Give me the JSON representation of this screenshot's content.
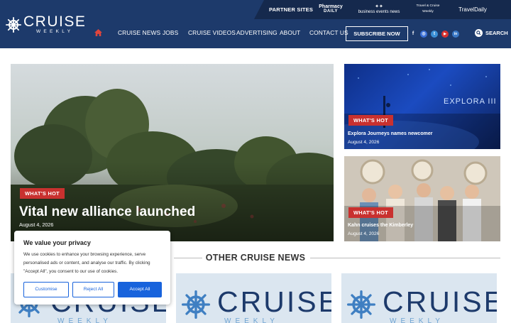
{
  "header": {
    "logo": {
      "main": "CRUISE",
      "sub": "WEEKLY"
    },
    "partner_label": "PARTNER SITES",
    "partners": [
      {
        "line1": "Pharmacy",
        "line2": "DAILY"
      },
      {
        "line1": "business events news",
        "line2": ""
      },
      {
        "line1": "Travel & Cruise",
        "line2": "Weekly"
      },
      {
        "line1": "TravelDaily",
        "line2": ""
      }
    ],
    "nav": [
      "CRUISE NEWS",
      "JOBS",
      "CRUISE VIDEOS",
      "ADVERTISING",
      "ABOUT",
      "CONTACT US"
    ],
    "subscribe_label": "SUBSCRIBE NOW",
    "social": [
      {
        "icon": "facebook-icon",
        "glyph": "f",
        "color": "#1d3a6b"
      },
      {
        "icon": "instagram-icon",
        "glyph": "◎",
        "color": "#3b6fd6"
      },
      {
        "icon": "twitter-icon",
        "glyph": "t",
        "color": "#3b8fd6"
      },
      {
        "icon": "youtube-icon",
        "glyph": "▶",
        "color": "#d6312f"
      },
      {
        "icon": "linkedin-icon",
        "glyph": "in",
        "color": "#3b79c7"
      }
    ],
    "search_label": "SEARCH"
  },
  "hero": {
    "badge": "WHAT'S HOT",
    "title": "Vital new alliance launched",
    "date": "August 4, 2026"
  },
  "side_stories": [
    {
      "badge": "WHAT'S HOT",
      "title": "Explora Journeys names newcomer",
      "date": "August 4, 2026",
      "image_text": "EXPLORA III"
    },
    {
      "badge": "WHAT'S HOT",
      "title": "Kahn cruises the Kimberley",
      "date": "August 4, 2026"
    }
  ],
  "section_title": "OTHER CRUISE NEWS",
  "thumbs": [
    {
      "word": "CRUISE",
      "sub": "WEEKLY"
    },
    {
      "word": "CRUISE",
      "sub": "WEEKLY"
    },
    {
      "word": "CRUISE",
      "sub": "WEEKLY"
    }
  ],
  "cookie": {
    "title": "We value your privacy",
    "text": "We use cookies to enhance your browsing experience, serve personalised ads or content, and analyse our traffic. By clicking \"Accept All\", you consent to our use of cookies.",
    "customise": "Customise",
    "reject": "Reject All",
    "accept": "Accept All"
  },
  "colors": {
    "header_bg": "#1d3a6b",
    "badge_red": "#c9312f",
    "cookie_blue": "#1863dc"
  }
}
